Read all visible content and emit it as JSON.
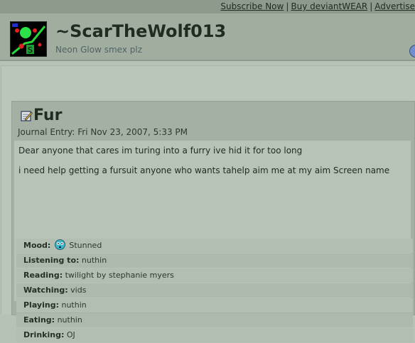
{
  "top_links": [
    "Subscribe Now",
    "Buy deviantWEAR",
    "Advertise"
  ],
  "profile": {
    "username": "~ScarTheWolf013",
    "tagline": "Neon Glow smex plz",
    "avatar_icon": "neon-glow-avatar-icon",
    "avatar_letter": "S"
  },
  "journal": {
    "title": "Fur",
    "date": "Journal Entry: Fri Nov 23, 2007, 5:33 PM",
    "paragraphs": [
      "Dear anyone that cares im turing into a furry ive hid it for too long",
      "i need help getting a fursuit anyone who wants tahelp aim me at my aim Screen name"
    ],
    "moods": [
      {
        "label": "Mood:",
        "value": "Stunned",
        "icon": "stunned-face-icon"
      },
      {
        "label": "Listening to:",
        "value": "nuthin"
      },
      {
        "label": "Reading:",
        "value": "twilight by stephanie myers"
      },
      {
        "label": "Watching:",
        "value": "vids"
      },
      {
        "label": "Playing:",
        "value": "nuthin"
      },
      {
        "label": "Eating:",
        "value": "nuthin"
      },
      {
        "label": "Drinking:",
        "value": "OJ"
      }
    ]
  },
  "colors": {
    "background": "#b7c2b6",
    "header": "#a1ad9f",
    "title_text": "#1f2c22",
    "tagline": "#4f6465"
  }
}
